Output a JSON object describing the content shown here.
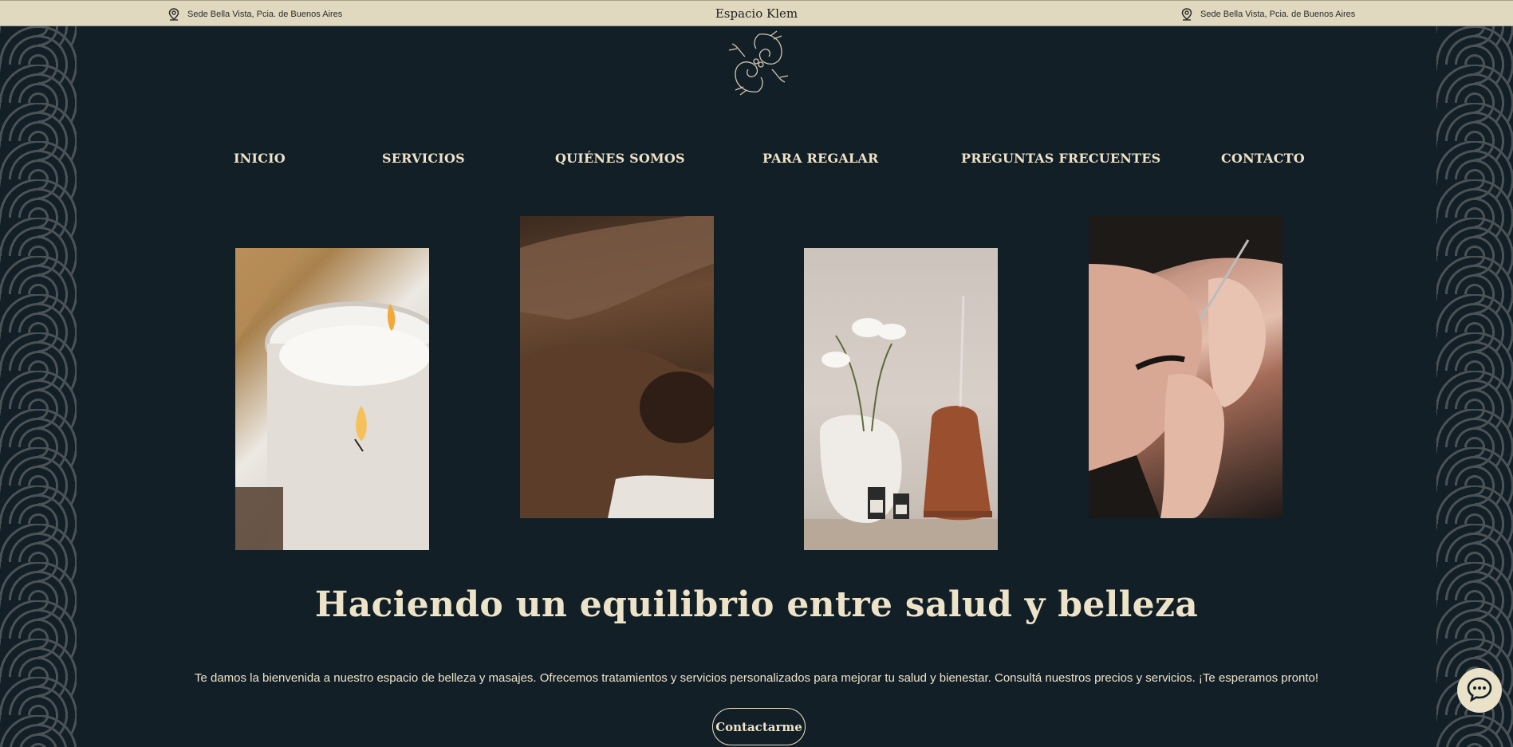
{
  "topbar": {
    "location_left": "Sede Bella Vista, Pcia. de Buenos Aires",
    "brand": "Espacio Klem",
    "location_right": "Sede Bella Vista, Pcia. de Buenos Aires"
  },
  "nav": {
    "items": [
      "INICIO",
      "SERVICIOS",
      "QUIÉNES SOMOS",
      "PARA REGALAR",
      "PREGUNTAS FRECUENTES",
      "CONTACTO"
    ]
  },
  "gallery": {
    "images": [
      "candles",
      "back-massage",
      "aroma-diffuser",
      "eyebrow-treatment"
    ]
  },
  "hero": {
    "headline": "Haciendo un equilibrio entre salud y belleza",
    "intro": "Te damos la bienvenida a nuestro espacio de belleza y masajes. Ofrecemos tratamientos y servicios personalizados para mejorar tu salud y bienestar. Consultá nuestros precios y servicios. ¡Te esperamos pronto!",
    "cta_label": "Contactarme"
  },
  "icons": {
    "pin": "map-pin-icon",
    "logo": "koi-fish-logo",
    "chat": "chat-bubble-icon"
  },
  "colors": {
    "background": "#131f27",
    "topbar": "#e1d9bf",
    "text": "#ede3c8",
    "pattern": "#4a5256"
  }
}
